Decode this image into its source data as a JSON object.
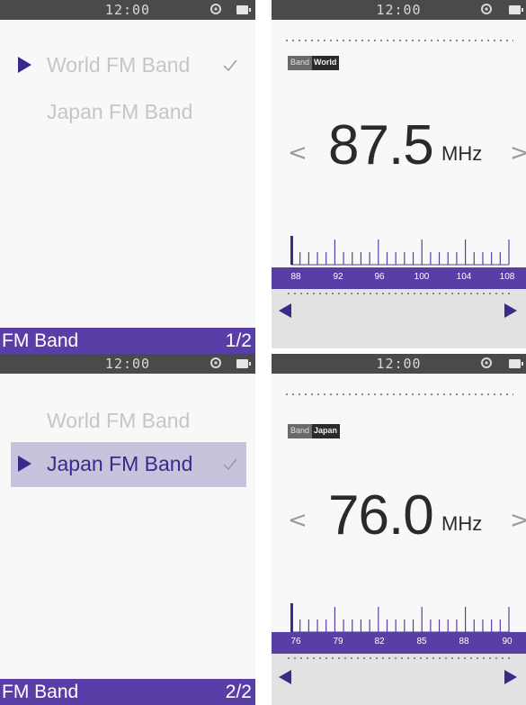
{
  "status": {
    "time": "12:00"
  },
  "menus": [
    {
      "items": [
        {
          "label": "World FM Band",
          "selected": true,
          "checked": true
        },
        {
          "label": "Japan FM Band",
          "selected": false,
          "checked": false
        }
      ],
      "footer_title": "FM Band",
      "page": "1/2"
    },
    {
      "items": [
        {
          "label": "World FM Band",
          "selected": false,
          "checked": false
        },
        {
          "label": "Japan FM Band",
          "selected": true,
          "checked": true
        }
      ],
      "footer_title": "FM Band",
      "page": "2/2"
    }
  ],
  "radios": [
    {
      "band_key": "Band",
      "band_value": "World",
      "frequency": "87.5",
      "unit": "MHz",
      "scale_labels": [
        "88",
        "92",
        "96",
        "100",
        "104",
        "108"
      ],
      "tuner_position": 0
    },
    {
      "band_key": "Band",
      "band_value": "Japan",
      "frequency": "76.0",
      "unit": "MHz",
      "scale_labels": [
        "76",
        "79",
        "82",
        "85",
        "88",
        "90"
      ],
      "tuner_position": 0
    }
  ],
  "colors": {
    "accent": "#5a3ea8",
    "selection": "#c8c3dd",
    "statusbar": "#4a4a4a"
  }
}
